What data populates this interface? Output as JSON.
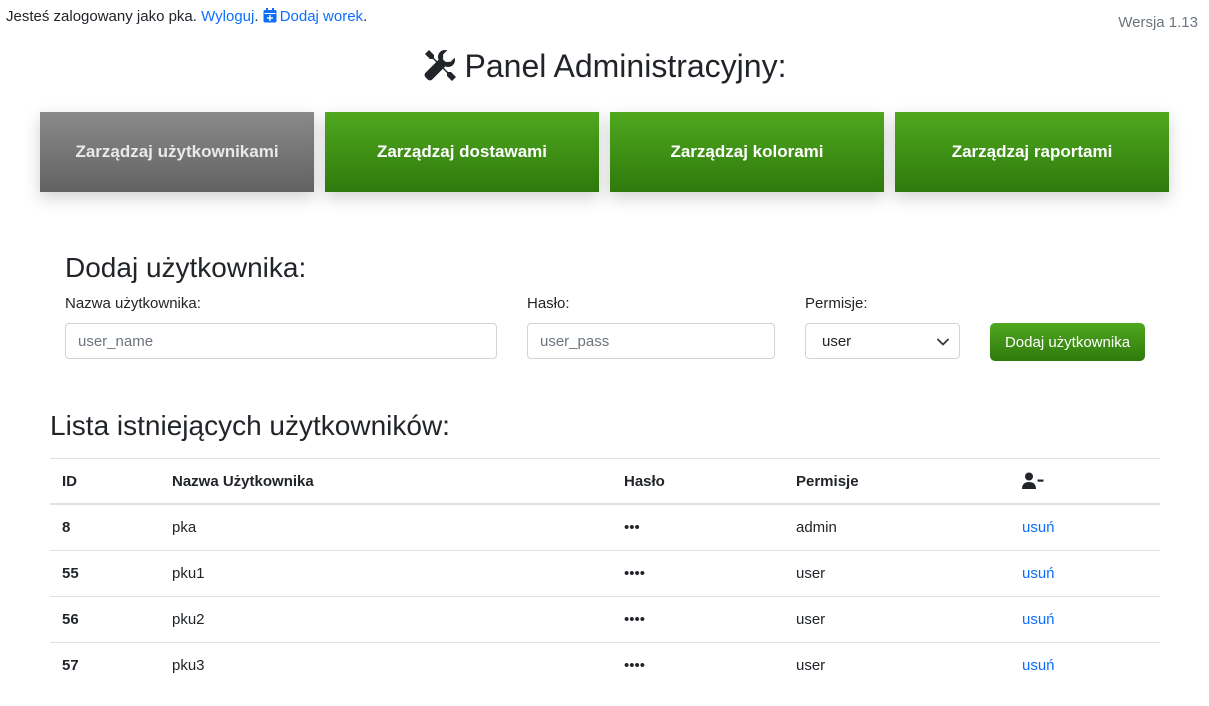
{
  "topbar": {
    "logged_in_text": "Jesteś zalogowany jako pka.",
    "logout_link": "Wyloguj",
    "separator": ".",
    "add_bag_link": "Dodaj worek",
    "trailing": ".",
    "version": "Wersja 1.13"
  },
  "header": {
    "title": "Panel Administracyjny:",
    "icon": "tools-icon"
  },
  "nav": {
    "users": "Zarządzaj użytkownikami",
    "deliveries": "Zarządzaj dostawami",
    "colors": "Zarządzaj kolorami",
    "reports": "Zarządzaj raportami"
  },
  "add_user_form": {
    "title": "Dodaj użytkownika:",
    "username_label": "Nazwa użytkownika:",
    "username_placeholder": "user_name",
    "password_label": "Hasło:",
    "password_placeholder": "user_pass",
    "permissions_label": "Permisje:",
    "permissions_selected": "user",
    "submit_label": "Dodaj użytkownika"
  },
  "users_list": {
    "title": "Lista istniejących użytkowników:",
    "columns": [
      "ID",
      "Nazwa Użytkownika",
      "Hasło",
      "Permisje"
    ],
    "delete_column_icon": "user-minus-icon",
    "rows": [
      {
        "id": "8",
        "name": "pka",
        "password": "•••",
        "permission": "admin",
        "action": "usuń"
      },
      {
        "id": "55",
        "name": "pku1",
        "password": "••••",
        "permission": "user",
        "action": "usuń"
      },
      {
        "id": "56",
        "name": "pku2",
        "password": "••••",
        "permission": "user",
        "action": "usuń"
      },
      {
        "id": "57",
        "name": "pku3",
        "password": "••••",
        "permission": "user",
        "action": "usuń"
      }
    ]
  },
  "colors": {
    "link": "#0d6efd",
    "green_button": "#3d8f14",
    "gray_button": "#777777"
  }
}
